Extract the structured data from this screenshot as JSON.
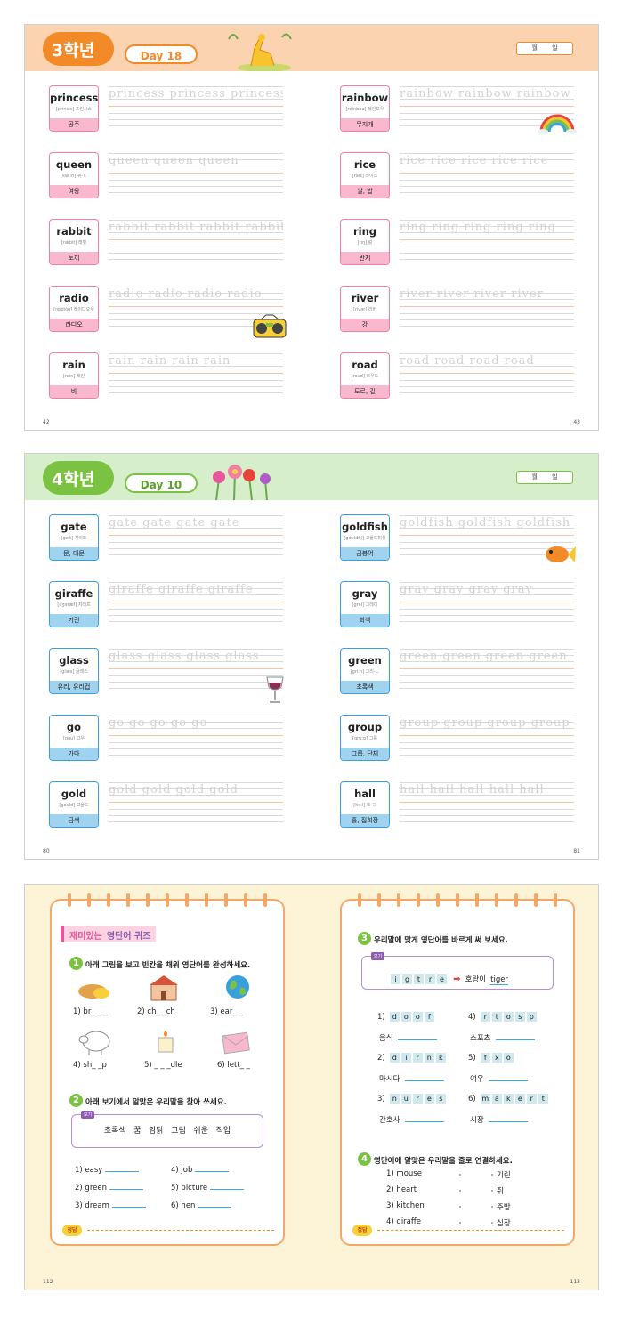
{
  "p1": {
    "grade": "3학년",
    "day": "Day 18",
    "date": "월 일",
    "page_left": "42",
    "page_right": "43",
    "left_words": [
      {
        "word": "princess",
        "pron": "[prínsis] 프린시스",
        "meaning": "공주",
        "trace": "princess princess princess"
      },
      {
        "word": "queen",
        "pron": "[kwi:n] 퀴-ㄴ",
        "meaning": "여왕",
        "trace": "queen queen queen"
      },
      {
        "word": "rabbit",
        "pron": "[rǽbit] 래빗",
        "meaning": "토끼",
        "trace": "rabbit rabbit rabbit rabbit"
      },
      {
        "word": "radio",
        "pron": "[réidiòu] 레이디오우",
        "meaning": "라디오",
        "trace": "radio radio radio radio"
      },
      {
        "word": "rain",
        "pron": "[rein] 레인",
        "meaning": "비",
        "trace": "rain rain rain rain"
      }
    ],
    "right_words": [
      {
        "word": "rainbow",
        "pron": "[réinbòu] 레인보우",
        "meaning": "무지개",
        "trace": "rainbow rainbow rainbow"
      },
      {
        "word": "rice",
        "pron": "[rais] 라이스",
        "meaning": "쌀, 밥",
        "trace": "rice rice rice rice rice"
      },
      {
        "word": "ring",
        "pron": "[riŋ] 링",
        "meaning": "반지",
        "trace": "ring ring ring ring ring"
      },
      {
        "word": "river",
        "pron": "[rívər] 리버",
        "meaning": "강",
        "trace": "river river river river"
      },
      {
        "word": "road",
        "pron": "[roud] 로우드",
        "meaning": "도로, 길",
        "trace": "road road road road"
      }
    ]
  },
  "p2": {
    "grade": "4학년",
    "day": "Day 10",
    "date": "월 일",
    "page_left": "80",
    "page_right": "81",
    "left_words": [
      {
        "word": "gate",
        "pron": "[geit] 게이트",
        "meaning": "문, 대문",
        "trace": "gate gate gate gate"
      },
      {
        "word": "giraffe",
        "pron": "[dʒərǽf] 저래프",
        "meaning": "기린",
        "trace": "giraffe giraffe giraffe"
      },
      {
        "word": "glass",
        "pron": "[glæs] 글래스",
        "meaning": "유리, 유리컵",
        "trace": "glass glass glass glass"
      },
      {
        "word": "go",
        "pron": "[gou] 고우",
        "meaning": "가다",
        "trace": "go go go go go"
      },
      {
        "word": "gold",
        "pron": "[gould] 고울드",
        "meaning": "금색",
        "trace": "gold gold gold gold"
      }
    ],
    "right_words": [
      {
        "word": "goldfish",
        "pron": "[góuldfiʃ] 고울드피쉬",
        "meaning": "금붕어",
        "trace": "goldfish goldfish goldfish"
      },
      {
        "word": "gray",
        "pron": "[grei] 그레이",
        "meaning": "회색",
        "trace": "gray gray gray gray"
      },
      {
        "word": "green",
        "pron": "[gri:n] 그리-ㄴ",
        "meaning": "초록색",
        "trace": "green green green green"
      },
      {
        "word": "group",
        "pron": "[gru:p] 그룹",
        "meaning": "그룹, 단체",
        "trace": "group group group group"
      },
      {
        "word": "hall",
        "pron": "[hɔ:l] 호-ㄹ",
        "meaning": "홀, 집회장",
        "trace": "hall hall hall hall hall"
      }
    ]
  },
  "p3": {
    "title_a": "재미있는",
    "title_b": "영단어 퀴즈",
    "page_left": "112",
    "page_right": "113",
    "answer_label": "정답",
    "q1": {
      "num": "1",
      "text": "아래 그림을 보고 빈칸을 채워 영단어를 완성하세요.",
      "items": [
        "1) br_ _ _",
        "2) ch_ _ch",
        "3) ear_ _",
        "4) sh_ _p",
        "5) _ _ _dle",
        "6) lett_ _"
      ]
    },
    "q2": {
      "num": "2",
      "text": "아래 보기에서 알맞은 우리말을 찾아 쓰세요.",
      "box_tag": "보기",
      "box_text": "초록색   꿈   암탉   그림   쉬운   직업",
      "items": [
        "1) easy",
        "4) job",
        "2) green",
        "5) picture",
        "3) dream",
        "6) hen"
      ]
    },
    "q3": {
      "num": "3",
      "text": "우리말에 맞게 영단어를 바르게 써 보세요.",
      "box_tag": "보기",
      "ex_letters": [
        "i",
        "g",
        "t",
        "r",
        "e"
      ],
      "ex_korean": "호랑이",
      "ex_answer": "tiger",
      "items": [
        {
          "n": "1)",
          "letters": [
            "d",
            "o",
            "o",
            "f"
          ],
          "korean": "음식"
        },
        {
          "n": "4)",
          "letters": [
            "r",
            "t",
            "o",
            "s",
            "p"
          ],
          "korean": "스포츠"
        },
        {
          "n": "2)",
          "letters": [
            "d",
            "i",
            "r",
            "n",
            "k"
          ],
          "korean": "마시다"
        },
        {
          "n": "5)",
          "letters": [
            "f",
            "x",
            "o"
          ],
          "korean": "여우"
        },
        {
          "n": "3)",
          "letters": [
            "n",
            "u",
            "r",
            "e",
            "s"
          ],
          "korean": "간호사"
        },
        {
          "n": "6)",
          "letters": [
            "m",
            "a",
            "k",
            "e",
            "r",
            "t"
          ],
          "korean": "시장"
        }
      ]
    },
    "q4": {
      "num": "4",
      "text": "영단어에 알맞은 우리말을 줄로 연결하세요.",
      "left": [
        "1) mouse",
        "2) heart",
        "3) kitchen",
        "4) giraffe"
      ],
      "right": [
        "기린",
        "쥐",
        "주방",
        "심장"
      ]
    }
  },
  "colors": {
    "pink": "#f07fa6",
    "pinkbg": "#f9b8cd",
    "orange": "#f28a28",
    "peach": "#fbd3b0",
    "blue": "#3aa0dc",
    "bluebg": "#9fd3f0",
    "green": "#7cc242",
    "greenbg": "#d7eecb",
    "cream": "#fdf3d6"
  }
}
